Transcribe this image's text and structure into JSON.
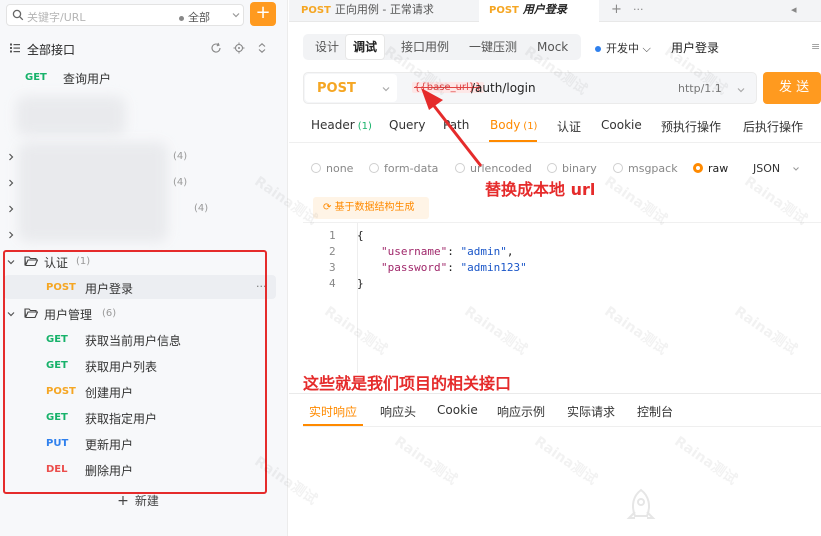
{
  "colors": {
    "accent": "#ff9a1f",
    "get": "#17b26a",
    "post": "#f5a623",
    "put": "#2f80ed",
    "del": "#eb4d4b",
    "annotation": "#e52b2b"
  },
  "sidebar": {
    "search_placeholder": "关键字/URL",
    "scope": "全部",
    "all_label": "全部接口",
    "add_icon": "+",
    "root_item": {
      "method": "GET",
      "label": "查询用户"
    },
    "hidden_folders": [
      {
        "count": "(4)"
      },
      {
        "count": "(4)"
      },
      {
        "count": "(4)"
      }
    ],
    "folder_auth": {
      "label": "认证",
      "count": "(1)"
    },
    "auth_items": [
      {
        "method": "POST",
        "label": "用户登录"
      }
    ],
    "folder_users": {
      "label": "用户管理",
      "count": "(6)"
    },
    "user_items": [
      {
        "method": "GET",
        "label": "获取当前用户信息"
      },
      {
        "method": "GET",
        "label": "获取用户列表"
      },
      {
        "method": "POST",
        "label": "创建用户"
      },
      {
        "method": "GET",
        "label": "获取指定用户"
      },
      {
        "method": "PUT",
        "label": "更新用户"
      },
      {
        "method": "DEL",
        "label": "删除用户"
      }
    ],
    "more": "···",
    "new_label": "新建"
  },
  "tabs": [
    {
      "method": "POST",
      "label": "正向用例 - 正常请求"
    },
    {
      "method": "POST",
      "label": "用户登录"
    }
  ],
  "tab_plus": "+",
  "tab_more": "···",
  "subtabs": [
    "设计",
    "调试",
    "接口用例",
    "一键压测",
    "Mock"
  ],
  "env": "开发中",
  "request_name": "用户登录",
  "url": {
    "method": "POST",
    "base": "{{base_url}}",
    "path": "/auth/login",
    "protocol": "http/1.1"
  },
  "send_label": "发 送",
  "param_tabs": [
    {
      "label": "Header",
      "count": "(1)"
    },
    {
      "label": "Query",
      "count": ""
    },
    {
      "label": "Path",
      "count": ""
    },
    {
      "label": "Body",
      "count": "(1)"
    },
    {
      "label": "认证",
      "count": ""
    },
    {
      "label": "Cookie",
      "count": ""
    },
    {
      "label": "预执行操作",
      "count": ""
    },
    {
      "label": "后执行操作",
      "count": ""
    }
  ],
  "body_types": [
    "none",
    "form-data",
    "urlencoded",
    "binary",
    "msgpack",
    "raw"
  ],
  "body_format": "JSON",
  "generate_label": "基于数据结构生成",
  "code": {
    "lines": [
      "1",
      "2",
      "3",
      "4"
    ],
    "open": "{",
    "close": "}",
    "username_key": "\"username\"",
    "username_val": "\"admin\"",
    "password_key": "\"password\"",
    "password_val": "\"admin123\"",
    "colon": ": ",
    "comma": ","
  },
  "annotations": {
    "replace_url": "替换成本地 url",
    "interfaces": "这些就是我们项目的相关接口"
  },
  "response_tabs": [
    "实时响应",
    "响应头",
    "Cookie",
    "响应示例",
    "实际请求",
    "控制台"
  ],
  "watermark": "Raina测试"
}
